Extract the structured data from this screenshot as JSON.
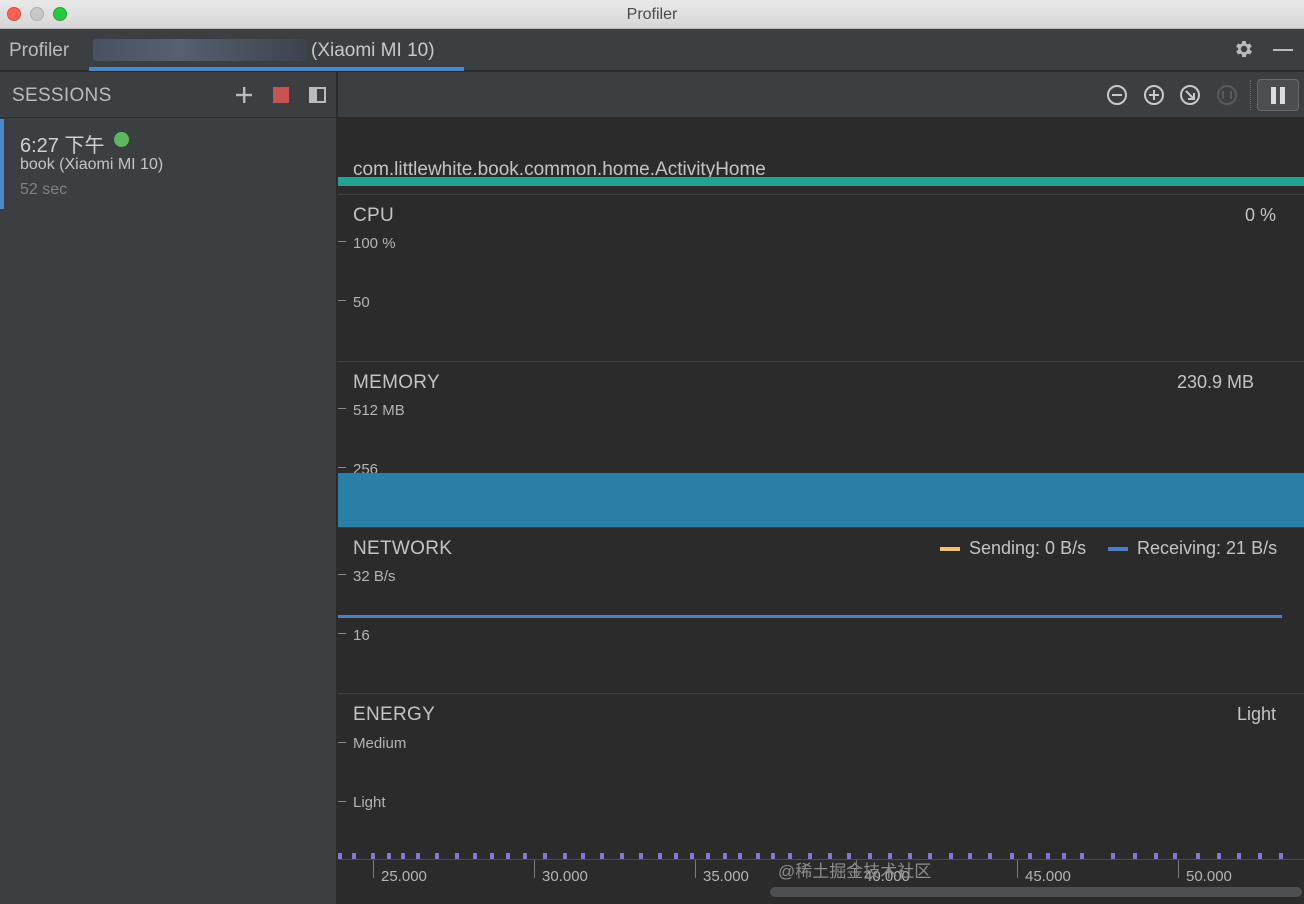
{
  "window": {
    "title": "Profiler"
  },
  "toolwindow": {
    "title": "Profiler",
    "device_label": "(Xiaomi MI 10)"
  },
  "sessions": {
    "title": "SESSIONS",
    "item": {
      "time": "6:27 下午",
      "name": "book (Xiaomi MI 10)",
      "duration": "52 sec",
      "status_color": "#5fb85f"
    }
  },
  "timeline": {
    "activity": "com.littlewhite.book.common.home.ActivityHome",
    "cpu": {
      "title": "CPU",
      "value": "0 %",
      "axis": [
        "100 %",
        "50"
      ],
      "level": 0
    },
    "memory": {
      "title": "MEMORY",
      "value": "230.9 MB",
      "axis": [
        "512 MB",
        "256"
      ],
      "level_mb": 230.9,
      "max_mb": 512
    },
    "network": {
      "title": "NETWORK",
      "axis": [
        "32 B/s",
        "16"
      ],
      "legend": [
        {
          "label": "Sending: 0 B/s",
          "color": "#f2c27a"
        },
        {
          "label": "Receiving: 21 B/s",
          "color": "#4f7ec7"
        }
      ],
      "receiving_value": 21,
      "max": 32
    },
    "energy": {
      "title": "ENERGY",
      "value": "Light",
      "axis": [
        "Medium",
        "Light"
      ]
    },
    "xaxis": [
      "25.000",
      "30.000",
      "35.000",
      "40.000",
      "45.000",
      "50.000"
    ]
  },
  "watermark": "@稀土掘金技术社区",
  "colors": {
    "accent": "#4a88c7",
    "activity": "#21a391",
    "memory": "#2a7fa6",
    "stop": "#c75450",
    "energy": "#8b74d1"
  }
}
